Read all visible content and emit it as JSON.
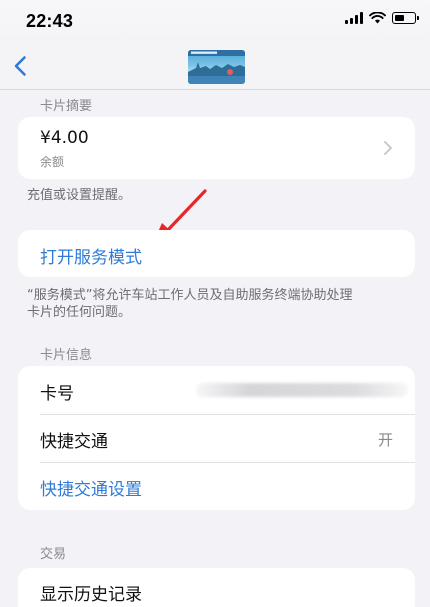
{
  "status_bar": {
    "time": "22:43"
  },
  "nav": {
    "back_icon": "chevron-left-icon",
    "card_image": "transit-card-thumbnail"
  },
  "summary": {
    "header": "卡片摘要",
    "balance_value": "¥4.00",
    "balance_label": "余额",
    "footnote": "充值或设置提醒。"
  },
  "service_mode": {
    "label": "打开服务模式",
    "footnote_line1": "“服务模式”将允许车站工作人员及自助服务终端协助处理",
    "footnote_line2": "卡片的任何问题。"
  },
  "card_info": {
    "header": "卡片信息",
    "card_number_label": "卡号",
    "express_transit_label": "快捷交通",
    "express_transit_value": "开",
    "express_transit_settings_label": "快捷交通设置"
  },
  "transactions": {
    "header": "交易",
    "history_label": "显示历史记录"
  },
  "colors": {
    "link": "#2f7bd7",
    "background": "#f2f2f7",
    "annotation_arrow": "#e8262a"
  }
}
